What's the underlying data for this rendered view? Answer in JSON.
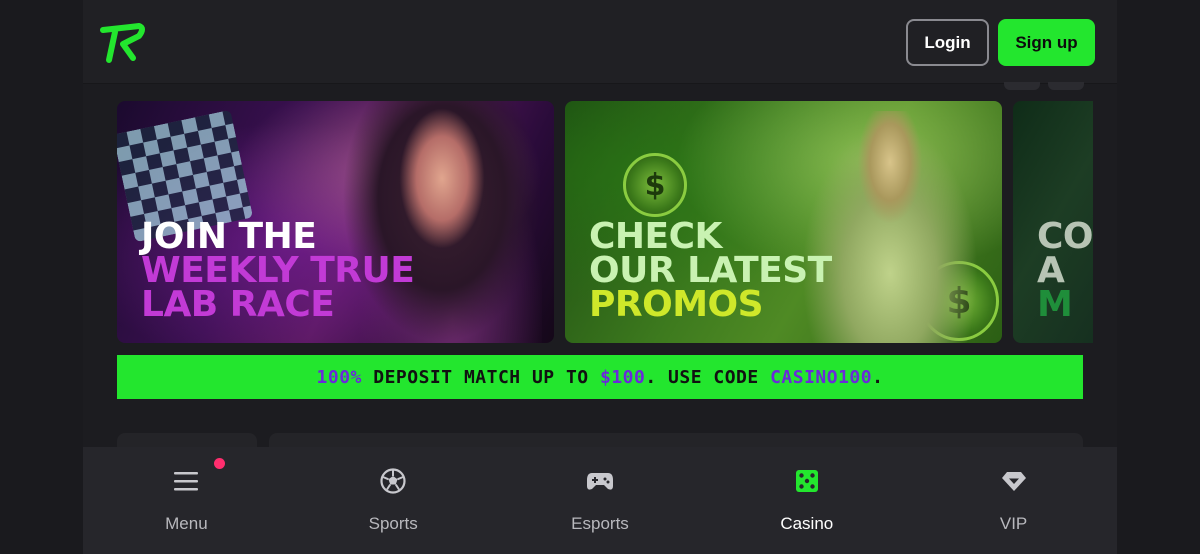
{
  "header": {
    "login_label": "Login",
    "signup_label": "Sign up",
    "accent": "#23e62e"
  },
  "banners": [
    {
      "lines": [
        "JOIN THE",
        "WEEKLY TRUE",
        "LAB RACE"
      ],
      "colors": [
        "#ffffff",
        "#c23ad6",
        "#c23ad6"
      ]
    },
    {
      "lines": [
        "CHECK",
        "OUR LATEST",
        "PROMOS"
      ],
      "colors": [
        "#c9f2b2",
        "#c9f2b2",
        "#cfe82a"
      ]
    },
    {
      "lines": [
        "CO",
        "A",
        "M"
      ],
      "colors": [
        "#b7c4b4",
        "#b7c4b4",
        "#1f8e3a"
      ]
    }
  ],
  "promo": {
    "part1": "100%",
    "part2": " DEPOSIT MATCH UP TO ",
    "part3": "$100",
    "part4": ". USE CODE ",
    "part5": "CASINO100",
    "part6": "."
  },
  "nav": {
    "items": [
      {
        "label": "Menu",
        "icon": "menu-icon",
        "active": false,
        "has_notification": true
      },
      {
        "label": "Sports",
        "icon": "soccer-ball-icon",
        "active": false
      },
      {
        "label": "Esports",
        "icon": "gamepad-icon",
        "active": false
      },
      {
        "label": "Casino",
        "icon": "dice-icon",
        "active": true
      },
      {
        "label": "VIP",
        "icon": "diamond-icon",
        "active": false
      }
    ]
  }
}
